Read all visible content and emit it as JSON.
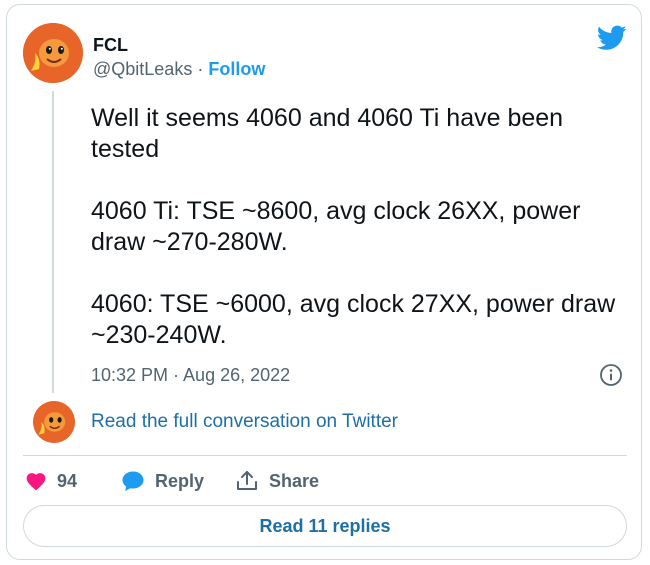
{
  "author": {
    "name": "FCL",
    "handle": "@QbitLeaks",
    "separator": " · ",
    "follow_label": "Follow",
    "avatar_icon": "charmander-avatar"
  },
  "brand_icon": "twitter-bird-icon",
  "tweet": {
    "text": "Well it seems 4060 and 4060 Ti have been tested\n\n4060 Ti: TSE ~8600, avg clock 26XX, power draw ~270-280W.\n\n4060: TSE ~6000, avg clock 27XX, power draw ~230-240W.",
    "timestamp": "10:32 PM · Aug 26, 2022"
  },
  "conversation_link": "Read the full conversation on Twitter",
  "actions": {
    "like_count": "94",
    "reply_label": "Reply",
    "share_label": "Share"
  },
  "read_replies_label": "Read 11 replies",
  "colors": {
    "accent": "#1d9bf0",
    "link": "#1d6fa5",
    "like": "#f91880",
    "text": "#0f1419",
    "muted": "#536471",
    "border": "#cfd9de"
  }
}
